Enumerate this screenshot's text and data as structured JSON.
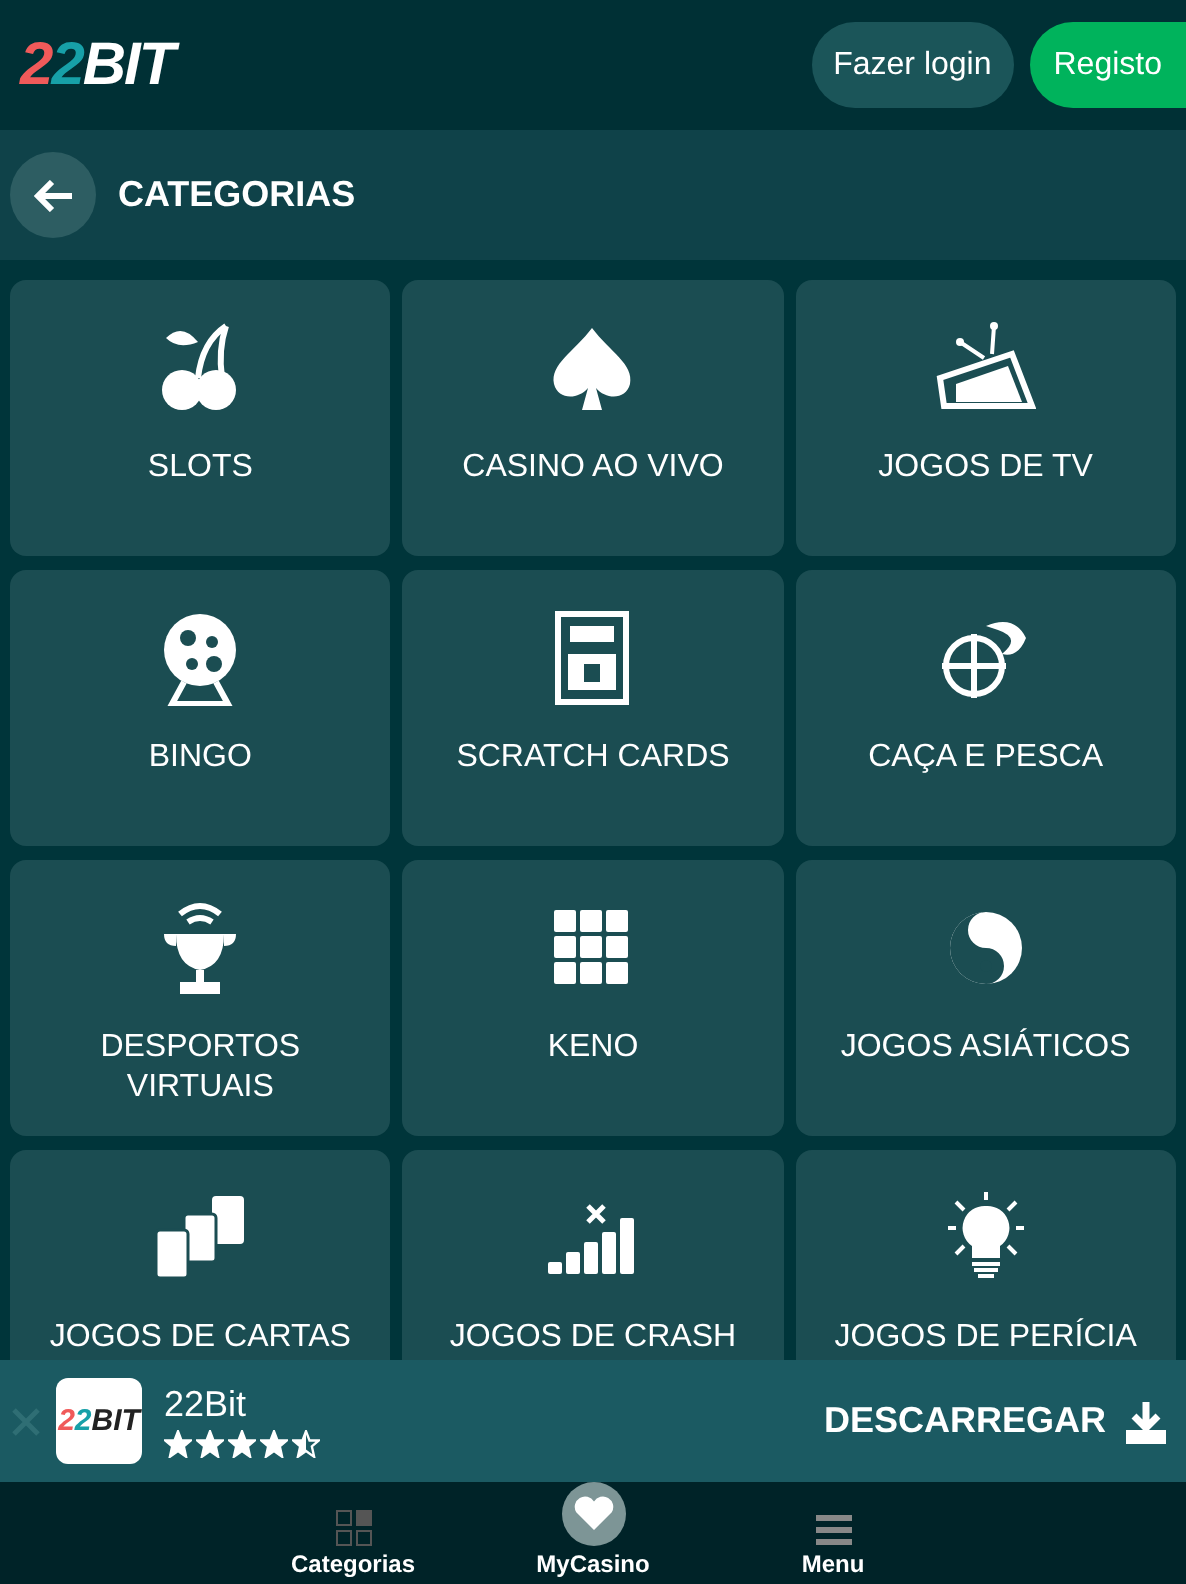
{
  "header": {
    "logo": {
      "part_1": "22",
      "part_2": "BIT"
    },
    "buttons": [
      {
        "label": "Fazer login",
        "kind": "secondary"
      },
      {
        "label": "Registo",
        "kind": "primary"
      }
    ]
  },
  "page_title": "CATEGORIAS",
  "categories": [
    {
      "label": "SLOTS"
    },
    {
      "label": "CASINO AO VIVO"
    },
    {
      "label": "JOGOS DE TV"
    },
    {
      "label": "BINGO"
    },
    {
      "label": "SCRATCH CARDS"
    },
    {
      "label": "CAÇA E PESCA"
    },
    {
      "label": "DESPORTOS VIRTUAIS"
    },
    {
      "label": "KENO"
    },
    {
      "label": "JOGOS ASIÁTICOS"
    },
    {
      "label": "JOGOS DE CARTAS"
    },
    {
      "label": "JOGOS DE CRASH"
    },
    {
      "label": "JOGOS DE PERÍCIA"
    }
  ],
  "app_banner": {
    "logo": {
      "part_1": "22",
      "part_2": "BIT"
    },
    "name": "22Bit",
    "stars": 4.5,
    "action": "DESCARREGAR"
  },
  "bottom_nav": [
    {
      "label": "Categorias"
    },
    {
      "label": "MyCasino"
    },
    {
      "label": "Menu"
    }
  ]
}
